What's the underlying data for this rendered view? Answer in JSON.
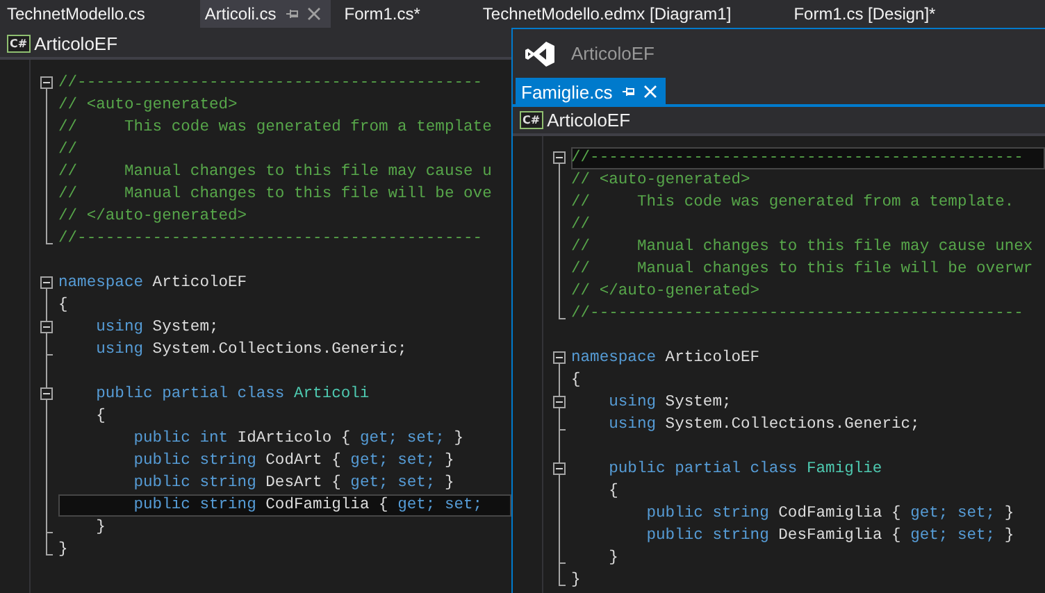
{
  "tabs": [
    {
      "label": "TechnetModello.cs",
      "selected": false
    },
    {
      "label": "Articoli.cs",
      "selected": true
    },
    {
      "label": "Form1.cs*",
      "selected": false
    },
    {
      "label": "TechnetModello.edmx [Diagram1]",
      "selected": false
    },
    {
      "label": "Form1.cs [Design]*",
      "selected": false
    }
  ],
  "editor": {
    "nav_bar": {
      "file_icon": "C#",
      "project": "ArticoloEF"
    },
    "lines": [
      {
        "collapsible": true,
        "in_block": false,
        "block_end": false,
        "current": false,
        "tokens": [
          {
            "kind": "comment",
            "text": "//-------------------------------------------"
          }
        ]
      },
      {
        "collapsible": false,
        "in_block": true,
        "block_end": false,
        "current": false,
        "tokens": [
          {
            "kind": "comment",
            "text": "// <auto-generated>"
          }
        ]
      },
      {
        "collapsible": false,
        "in_block": true,
        "block_end": false,
        "current": false,
        "tokens": [
          {
            "kind": "comment",
            "text": "//     This code was generated from a template"
          }
        ]
      },
      {
        "collapsible": false,
        "in_block": true,
        "block_end": false,
        "current": false,
        "tokens": [
          {
            "kind": "comment",
            "text": "//"
          }
        ]
      },
      {
        "collapsible": false,
        "in_block": true,
        "block_end": false,
        "current": false,
        "tokens": [
          {
            "kind": "comment",
            "text": "//     Manual changes to this file may cause u"
          }
        ]
      },
      {
        "collapsible": false,
        "in_block": true,
        "block_end": false,
        "current": false,
        "tokens": [
          {
            "kind": "comment",
            "text": "//     Manual changes to this file will be ove"
          }
        ]
      },
      {
        "collapsible": false,
        "in_block": true,
        "block_end": false,
        "current": false,
        "tokens": [
          {
            "kind": "comment",
            "text": "// </auto-generated>"
          }
        ]
      },
      {
        "collapsible": false,
        "in_block": false,
        "block_end": true,
        "current": false,
        "tokens": [
          {
            "kind": "comment",
            "text": "//-------------------------------------------"
          }
        ]
      },
      {
        "collapsible": false,
        "in_block": false,
        "block_end": false,
        "current": false
      },
      {
        "collapsible": true,
        "in_block": false,
        "block_end": false,
        "current": false,
        "tokens": [
          {
            "kind": "keyword",
            "text": "namespace"
          },
          {
            "kind": "plain",
            "text": " ArticoloEF"
          }
        ]
      },
      {
        "collapsible": false,
        "in_block": true,
        "block_end": false,
        "current": false,
        "tokens": [
          {
            "kind": "plain",
            "text": "{"
          }
        ]
      },
      {
        "collapsible": true,
        "in_block": true,
        "block_end": false,
        "current": false,
        "tokens": [
          {
            "kind": "keyword",
            "text": "    using"
          },
          {
            "kind": "plain",
            "text": " System;"
          }
        ]
      },
      {
        "collapsible": false,
        "in_block": true,
        "block_end": true,
        "current": false,
        "tokens": [
          {
            "kind": "keyword",
            "text": "    using"
          },
          {
            "kind": "plain",
            "text": " System.Collections.Generic;"
          }
        ]
      },
      {
        "collapsible": false,
        "in_block": true,
        "block_end": false,
        "current": false
      },
      {
        "collapsible": true,
        "in_block": true,
        "block_end": false,
        "current": false,
        "tokens": [
          {
            "kind": "keyword",
            "text": "    public partial class"
          },
          {
            "kind": "type",
            "text": " Articoli"
          }
        ]
      },
      {
        "collapsible": false,
        "in_block": true,
        "block_end": false,
        "current": false,
        "tokens": [
          {
            "kind": "plain",
            "text": "    {"
          }
        ]
      },
      {
        "collapsible": false,
        "in_block": true,
        "block_end": false,
        "current": false,
        "tokens": [
          {
            "kind": "keyword",
            "text": "        public int"
          },
          {
            "kind": "plain",
            "text": " IdArticolo {"
          },
          {
            "kind": "keyword",
            "text": " get; set;"
          },
          {
            "kind": "plain",
            "text": " }"
          }
        ]
      },
      {
        "collapsible": false,
        "in_block": true,
        "block_end": false,
        "current": false,
        "tokens": [
          {
            "kind": "keyword",
            "text": "        public string"
          },
          {
            "kind": "plain",
            "text": " CodArt {"
          },
          {
            "kind": "keyword",
            "text": " get; set;"
          },
          {
            "kind": "plain",
            "text": " }"
          }
        ]
      },
      {
        "collapsible": false,
        "in_block": true,
        "block_end": false,
        "current": false,
        "tokens": [
          {
            "kind": "keyword",
            "text": "        public string"
          },
          {
            "kind": "plain",
            "text": " DesArt {"
          },
          {
            "kind": "keyword",
            "text": " get; set;"
          },
          {
            "kind": "plain",
            "text": " }"
          }
        ]
      },
      {
        "collapsible": false,
        "in_block": true,
        "block_end": false,
        "current": true,
        "tokens": [
          {
            "kind": "keyword",
            "text": "        public string"
          },
          {
            "kind": "plain",
            "text": " CodFamiglia {"
          },
          {
            "kind": "keyword",
            "text": " get; set;"
          }
        ]
      },
      {
        "collapsible": false,
        "in_block": true,
        "block_end": true,
        "current": false,
        "tokens": [
          {
            "kind": "plain",
            "text": "    }"
          }
        ]
      },
      {
        "collapsible": false,
        "in_block": false,
        "block_end": true,
        "current": false,
        "tokens": [
          {
            "kind": "plain",
            "text": "}"
          }
        ]
      }
    ]
  },
  "floating_window": {
    "title": "ArticoloEF",
    "tabs": [
      {
        "label": "Famiglie.cs",
        "selected": true
      }
    ],
    "editor": {
      "nav_bar": {
        "file_icon": "C#",
        "project": "ArticoloEF"
      },
      "lines": [
        {
          "collapsible": true,
          "in_block": false,
          "block_end": false,
          "current": true,
          "tokens": [
            {
              "kind": "comment",
              "text": "//----------------------------------------------"
            }
          ]
        },
        {
          "collapsible": false,
          "in_block": true,
          "block_end": false,
          "current": false,
          "tokens": [
            {
              "kind": "comment",
              "text": "// <auto-generated>"
            }
          ]
        },
        {
          "collapsible": false,
          "in_block": true,
          "block_end": false,
          "current": false,
          "tokens": [
            {
              "kind": "comment",
              "text": "//     This code was generated from a template."
            }
          ]
        },
        {
          "collapsible": false,
          "in_block": true,
          "block_end": false,
          "current": false,
          "tokens": [
            {
              "kind": "comment",
              "text": "//"
            }
          ]
        },
        {
          "collapsible": false,
          "in_block": true,
          "block_end": false,
          "current": false,
          "tokens": [
            {
              "kind": "comment",
              "text": "//     Manual changes to this file may cause unex"
            }
          ]
        },
        {
          "collapsible": false,
          "in_block": true,
          "block_end": false,
          "current": false,
          "tokens": [
            {
              "kind": "comment",
              "text": "//     Manual changes to this file will be overwr"
            }
          ]
        },
        {
          "collapsible": false,
          "in_block": true,
          "block_end": false,
          "current": false,
          "tokens": [
            {
              "kind": "comment",
              "text": "// </auto-generated>"
            }
          ]
        },
        {
          "collapsible": false,
          "in_block": false,
          "block_end": true,
          "current": false,
          "tokens": [
            {
              "kind": "comment",
              "text": "//----------------------------------------------"
            }
          ]
        },
        {
          "collapsible": false,
          "in_block": false,
          "block_end": false,
          "current": false
        },
        {
          "collapsible": true,
          "in_block": false,
          "block_end": false,
          "current": false,
          "tokens": [
            {
              "kind": "keyword",
              "text": "namespace"
            },
            {
              "kind": "plain",
              "text": " ArticoloEF"
            }
          ]
        },
        {
          "collapsible": false,
          "in_block": true,
          "block_end": false,
          "current": false,
          "tokens": [
            {
              "kind": "plain",
              "text": "{"
            }
          ]
        },
        {
          "collapsible": true,
          "in_block": true,
          "block_end": false,
          "current": false,
          "tokens": [
            {
              "kind": "keyword",
              "text": "    using"
            },
            {
              "kind": "plain",
              "text": " System;"
            }
          ]
        },
        {
          "collapsible": false,
          "in_block": true,
          "block_end": true,
          "current": false,
          "tokens": [
            {
              "kind": "keyword",
              "text": "    using"
            },
            {
              "kind": "plain",
              "text": " System.Collections.Generic;"
            }
          ]
        },
        {
          "collapsible": false,
          "in_block": true,
          "block_end": false,
          "current": false
        },
        {
          "collapsible": true,
          "in_block": true,
          "block_end": false,
          "current": false,
          "tokens": [
            {
              "kind": "keyword",
              "text": "    public partial class"
            },
            {
              "kind": "type",
              "text": " Famiglie"
            }
          ]
        },
        {
          "collapsible": false,
          "in_block": true,
          "block_end": false,
          "current": false,
          "tokens": [
            {
              "kind": "plain",
              "text": "    {"
            }
          ]
        },
        {
          "collapsible": false,
          "in_block": true,
          "block_end": false,
          "current": false,
          "tokens": [
            {
              "kind": "keyword",
              "text": "        public string"
            },
            {
              "kind": "plain",
              "text": " CodFamiglia {"
            },
            {
              "kind": "keyword",
              "text": " get; set;"
            },
            {
              "kind": "plain",
              "text": " }"
            }
          ]
        },
        {
          "collapsible": false,
          "in_block": true,
          "block_end": false,
          "current": false,
          "tokens": [
            {
              "kind": "keyword",
              "text": "        public string"
            },
            {
              "kind": "plain",
              "text": " DesFamiglia {"
            },
            {
              "kind": "keyword",
              "text": " get; set;"
            },
            {
              "kind": "plain",
              "text": " }"
            }
          ]
        },
        {
          "collapsible": false,
          "in_block": true,
          "block_end": true,
          "current": false,
          "tokens": [
            {
              "kind": "plain",
              "text": "    }"
            }
          ]
        },
        {
          "collapsible": false,
          "in_block": false,
          "block_end": true,
          "current": false,
          "tokens": [
            {
              "kind": "plain",
              "text": "}"
            }
          ]
        }
      ]
    }
  }
}
